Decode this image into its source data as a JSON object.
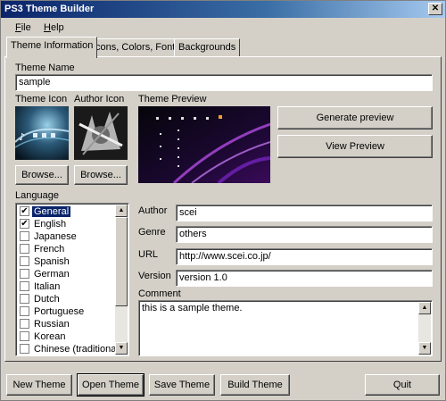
{
  "window": {
    "title": "PS3 Theme Builder"
  },
  "menu": [
    {
      "accel": "F",
      "rest": "ile"
    },
    {
      "accel": "H",
      "rest": "elp"
    }
  ],
  "tabs": [
    "Theme Information",
    "Icons, Colors, Font",
    "Backgrounds"
  ],
  "theme_name": {
    "label": "Theme Name",
    "value": "sample"
  },
  "theme_icon": {
    "label": "Theme Icon",
    "browse": "Browse..."
  },
  "author_icon": {
    "label": "Author Icon",
    "browse": "Browse..."
  },
  "preview": {
    "label": "Theme Preview",
    "generate": "Generate preview",
    "view": "View Preview"
  },
  "language": {
    "label": "Language",
    "items": [
      {
        "name": "General",
        "checked": "✔",
        "selected": true
      },
      {
        "name": "English",
        "checked": "✔"
      },
      {
        "name": "Japanese",
        "checked": ""
      },
      {
        "name": "French",
        "checked": ""
      },
      {
        "name": "Spanish",
        "checked": ""
      },
      {
        "name": "German",
        "checked": ""
      },
      {
        "name": "Italian",
        "checked": ""
      },
      {
        "name": "Dutch",
        "checked": ""
      },
      {
        "name": "Portuguese",
        "checked": ""
      },
      {
        "name": "Russian",
        "checked": ""
      },
      {
        "name": "Korean",
        "checked": ""
      },
      {
        "name": "Chinese (traditional)",
        "checked": ""
      }
    ]
  },
  "author": {
    "label": "Author",
    "value": "scei"
  },
  "genre": {
    "label": "Genre",
    "value": "others"
  },
  "url": {
    "label": "URL",
    "value": "http://www.scei.co.jp/"
  },
  "version": {
    "label": "Version",
    "value": "version 1.0"
  },
  "comment": {
    "label": "Comment",
    "value": "this is a sample theme."
  },
  "buttons": {
    "new": "New Theme",
    "open": "Open Theme",
    "save": "Save Theme",
    "build": "Build Theme",
    "quit": "Quit"
  },
  "colors": {
    "title_start": "#0a246a",
    "selection": "#0a246a",
    "face": "#d4d0c8",
    "preview_bg": "#0b0b14",
    "preview_glow": "#8a2be2"
  }
}
